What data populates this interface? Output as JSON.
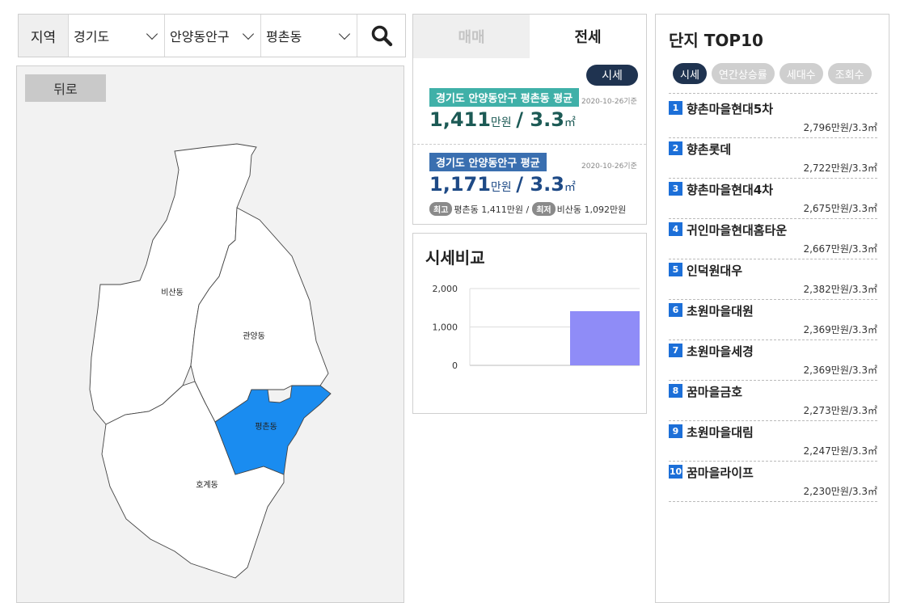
{
  "search": {
    "region_label": "지역",
    "province": "경기도",
    "district": "안양동안구",
    "dong": "평촌동",
    "search_icon": "search-icon"
  },
  "map": {
    "back_label": "뒤로",
    "districts": [
      {
        "name": "비산동",
        "selected": false
      },
      {
        "name": "관양동",
        "selected": false
      },
      {
        "name": "평촌동",
        "selected": true
      },
      {
        "name": "호계동",
        "selected": false
      }
    ],
    "colors": {
      "selected": "#1a8cf0",
      "default": "#ffffff",
      "background": "#f2f2f2"
    }
  },
  "price": {
    "tabs": [
      {
        "label": "매매",
        "active": false
      },
      {
        "label": "전세",
        "active": true
      }
    ],
    "sise_button": "시세",
    "dong_avg": {
      "title": "경기도 안양동안구 평촌동 평균",
      "date": "2020-10-26기준",
      "value": "1,411",
      "unit_price": "만원",
      "area": "/ 3.3",
      "area_unit": "㎡"
    },
    "district_avg": {
      "title": "경기도 안양동안구 평균",
      "date": "2020-10-26기준",
      "value": "1,171",
      "unit_price": "만원",
      "area": "/ 3.3",
      "area_unit": "㎡"
    },
    "max_badge": "최고",
    "max_text": "평촌동 1,411만원 /",
    "min_badge": "최저",
    "min_text": "비산동 1,092만원"
  },
  "compare": {
    "title": "시세비교"
  },
  "chart_data": {
    "type": "bar",
    "categories": [
      ""
    ],
    "values": [
      1411
    ],
    "ylim": [
      0,
      2000
    ],
    "yticks": [
      "2,000",
      "1,000",
      "0"
    ],
    "ytick_values": [
      2000,
      1000,
      0
    ],
    "grid": true,
    "bar_color": "#8f8cf7"
  },
  "top10": {
    "title": "단지 TOP10",
    "filters": [
      {
        "label": "시세",
        "active": true
      },
      {
        "label": "연간상승률",
        "active": false
      },
      {
        "label": "세대수",
        "active": false
      },
      {
        "label": "조회수",
        "active": false
      }
    ],
    "items": [
      {
        "rank": "1",
        "name": "향촌마을현대5차",
        "price": "2,796만원/3.3㎡"
      },
      {
        "rank": "2",
        "name": "향촌롯데",
        "price": "2,722만원/3.3㎡"
      },
      {
        "rank": "3",
        "name": "향촌마을현대4차",
        "price": "2,675만원/3.3㎡"
      },
      {
        "rank": "4",
        "name": "귀인마을현대홈타운",
        "price": "2,667만원/3.3㎡"
      },
      {
        "rank": "5",
        "name": "인덕원대우",
        "price": "2,382만원/3.3㎡"
      },
      {
        "rank": "6",
        "name": "초원마을대원",
        "price": "2,369만원/3.3㎡"
      },
      {
        "rank": "7",
        "name": "초원마을세경",
        "price": "2,369만원/3.3㎡"
      },
      {
        "rank": "8",
        "name": "꿈마을금호",
        "price": "2,273만원/3.3㎡"
      },
      {
        "rank": "9",
        "name": "초원마을대림",
        "price": "2,247만원/3.3㎡"
      },
      {
        "rank": "10",
        "name": "꿈마을라이프",
        "price": "2,230만원/3.3㎡"
      }
    ]
  }
}
